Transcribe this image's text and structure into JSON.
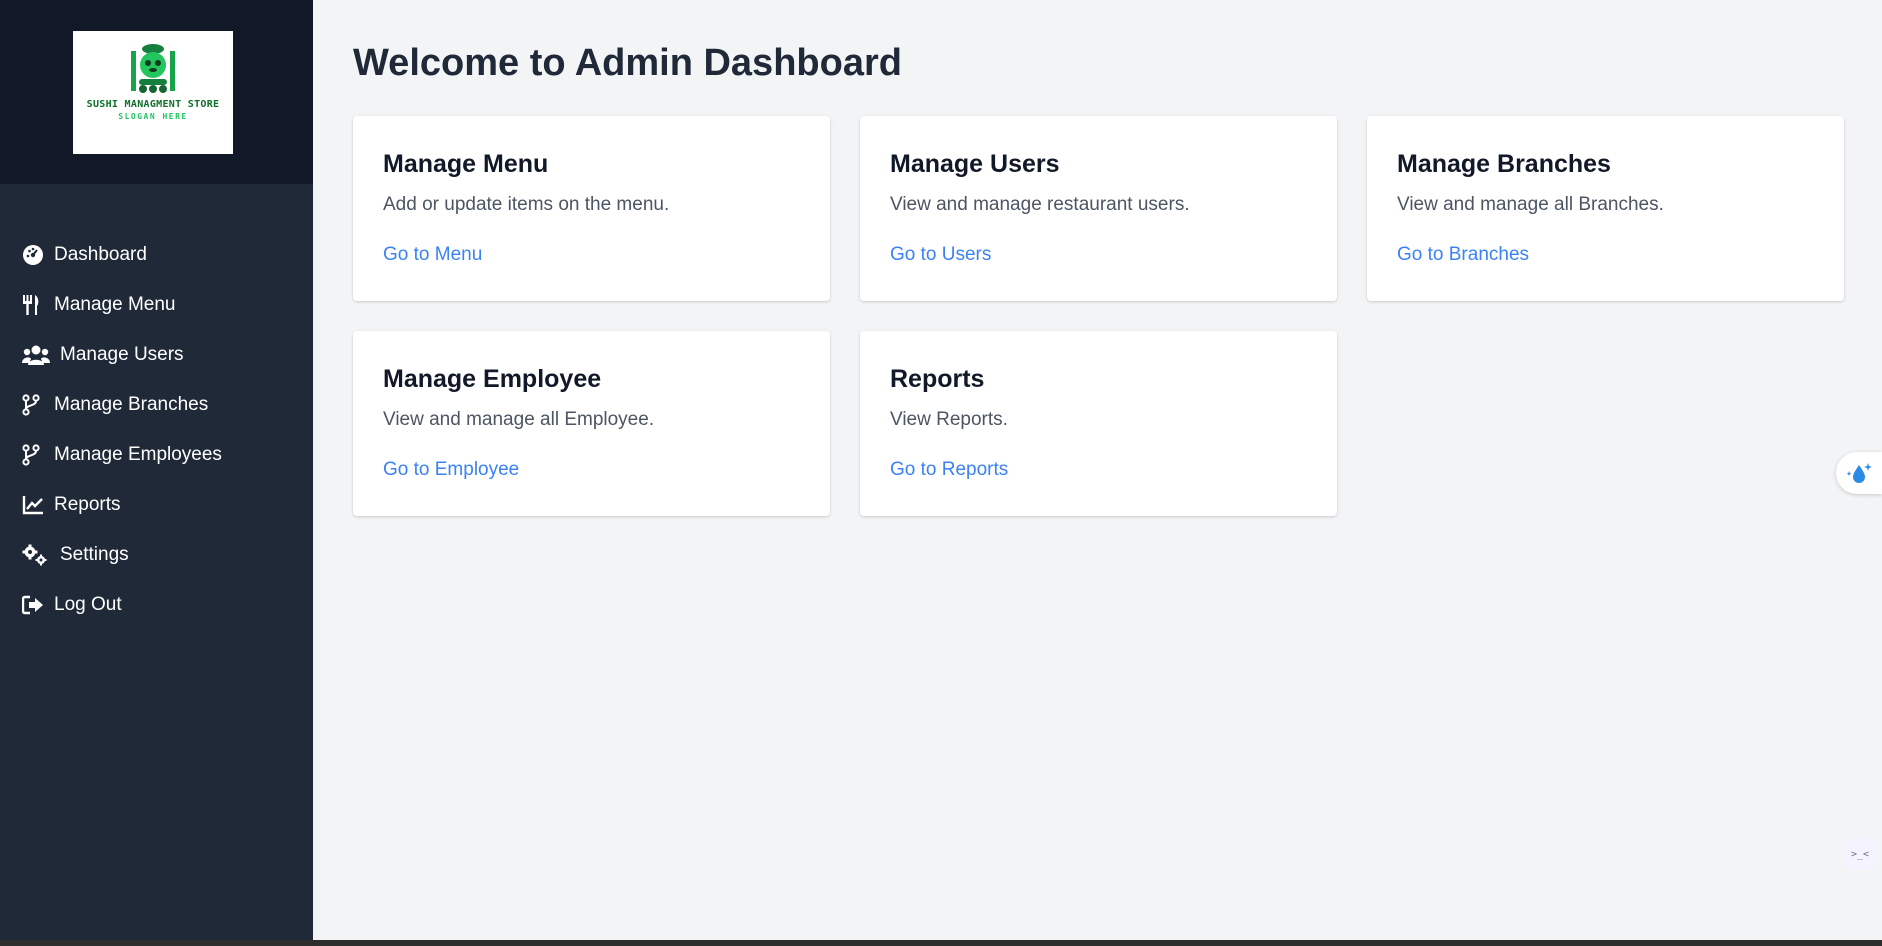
{
  "logo": {
    "title": "SUSHI MANAGMENT STORE",
    "slogan": "SLOGAN HERE"
  },
  "sidebar": {
    "items": [
      {
        "label": "Dashboard",
        "icon": "dashboard-gauge-icon"
      },
      {
        "label": "Manage Menu",
        "icon": "utensils-icon"
      },
      {
        "label": "Manage Users",
        "icon": "users-icon"
      },
      {
        "label": "Manage Branches",
        "icon": "code-branch-icon"
      },
      {
        "label": "Manage Employees",
        "icon": "code-branch-icon"
      },
      {
        "label": "Reports",
        "icon": "line-chart-icon"
      },
      {
        "label": "Settings",
        "icon": "gears-icon"
      },
      {
        "label": "Log Out",
        "icon": "sign-out-icon"
      }
    ]
  },
  "main": {
    "title": "Welcome to Admin Dashboard",
    "cards": [
      {
        "title": "Manage Menu",
        "description": "Add or update items on the menu.",
        "link": "Go to Menu"
      },
      {
        "title": "Manage Users",
        "description": "View and manage restaurant users.",
        "link": "Go to Users"
      },
      {
        "title": "Manage Branches",
        "description": "View and manage all Branches.",
        "link": "Go to Branches"
      },
      {
        "title": "Manage Employee",
        "description": "View and manage all Employee.",
        "link": "Go to Employee"
      },
      {
        "title": "Reports",
        "description": "View Reports.",
        "link": "Go to Reports"
      }
    ]
  },
  "widgets": {
    "float_button_icon": "sparkle-drop-icon",
    "corner_face": ">_<"
  },
  "colors": {
    "sidebar_bg": "#1f2937",
    "sidebar_header_bg": "#111827",
    "page_bg": "#f3f4f6",
    "link": "#3b82f6",
    "title": "#1f2937"
  }
}
